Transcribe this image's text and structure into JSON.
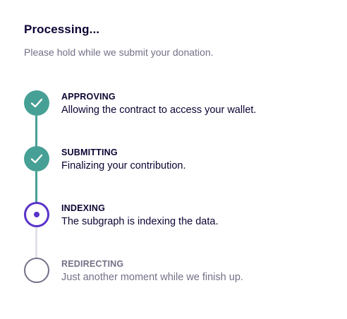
{
  "modal": {
    "title": "Processing...",
    "subtitle": "Please hold while we submit your donation."
  },
  "steps": [
    {
      "name": "APPROVING",
      "description": "Allowing the contract to access your wallet.",
      "status": "complete",
      "icon": "check-icon"
    },
    {
      "name": "SUBMITTING",
      "description": "Finalizing your contribution.",
      "status": "complete",
      "icon": "check-icon"
    },
    {
      "name": "INDEXING",
      "description": "The subgraph is indexing the data.",
      "status": "current",
      "icon": "current-dot-icon"
    },
    {
      "name": "REDIRECTING",
      "description": "Just another moment while we finish up.",
      "status": "upcoming",
      "icon": "empty-circle-icon"
    }
  ],
  "colors": {
    "complete": "#47a095",
    "current": "#5932c9",
    "upcoming": "#757087",
    "connector_pending": "#e2e0e7",
    "text_primary": "#0e0333",
    "text_muted": "#757087"
  }
}
